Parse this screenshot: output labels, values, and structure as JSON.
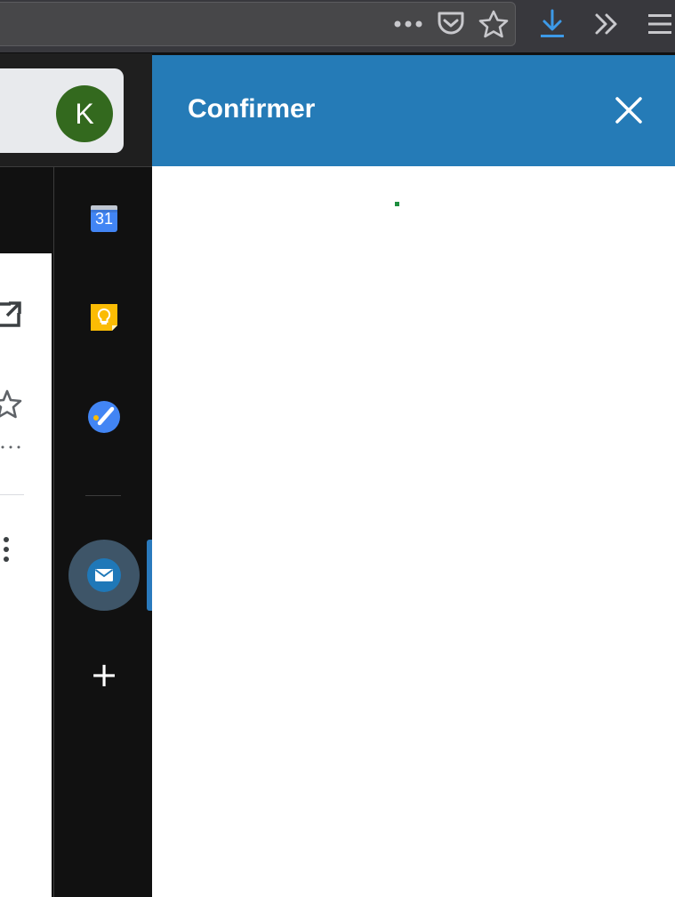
{
  "browser": {
    "toolbar_icons": [
      "more-actions-icon",
      "pocket-icon",
      "bookmark-star-icon",
      "downloads-icon",
      "overflow-chevron-icon",
      "hamburger-menu-icon"
    ],
    "downloads_color": "#3d9ae8"
  },
  "gmail": {
    "account_initial": "K",
    "account_color": "#33691e"
  },
  "side_panel": {
    "apps": [
      "calendar-icon",
      "keep-icon",
      "tasks-icon",
      "mail-addon-icon"
    ],
    "calendar_day": "31",
    "add_label": "+",
    "accent_color": "#2a7abd"
  },
  "dialog": {
    "title": "Confirmer",
    "header_color": "#257bb7"
  }
}
